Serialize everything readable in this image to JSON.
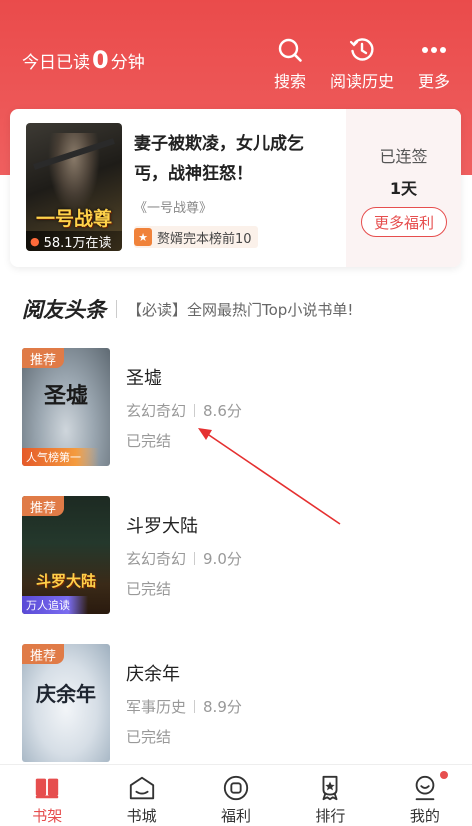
{
  "header": {
    "reading_prefix": "今日已读",
    "reading_minutes": "0",
    "reading_suffix": "分钟",
    "actions": [
      {
        "label": "搜索",
        "icon": "search-icon"
      },
      {
        "label": "阅读历史",
        "icon": "history-icon"
      },
      {
        "label": "更多",
        "icon": "more-icon"
      }
    ]
  },
  "promo": {
    "title": "妻子被欺凌，女儿成乞丐，战神狂怒！",
    "cover_title": "一号战尊",
    "readers": "58.1万在读",
    "book_ref": "《一号战尊》",
    "rank": "赘婿完本榜前10",
    "sign_label": "已连签",
    "sign_days": "1天",
    "more_button": "更多福利"
  },
  "section": {
    "title": "阅友头条",
    "subtitle": "【必读】全网最热门Top小说书单!"
  },
  "books": [
    {
      "title": "圣墟",
      "genre": "玄幻奇幻",
      "score": "8.6分",
      "status": "已完结",
      "badge": "推荐",
      "ribbon": "人气榜第一",
      "cover_text": "圣墟"
    },
    {
      "title": "斗罗大陆",
      "genre": "玄幻奇幻",
      "score": "9.0分",
      "status": "已完结",
      "badge": "推荐",
      "ribbon": "万人追读",
      "cover_text": "斗罗大陆"
    },
    {
      "title": "庆余年",
      "genre": "军事历史",
      "score": "8.9分",
      "status": "已完结",
      "badge": "推荐",
      "ribbon": "",
      "cover_text": "庆余年"
    }
  ],
  "tabs": [
    {
      "label": "书架",
      "icon": "bookshelf-icon",
      "active": true
    },
    {
      "label": "书城",
      "icon": "bookstore-icon",
      "active": false
    },
    {
      "label": "福利",
      "icon": "welfare-icon",
      "active": false
    },
    {
      "label": "排行",
      "icon": "ranking-icon",
      "active": false
    },
    {
      "label": "我的",
      "icon": "profile-icon",
      "active": false
    }
  ],
  "colors": {
    "brand": "#ea4b4b",
    "badge": "#e07b47",
    "annotation": "#e53030"
  }
}
